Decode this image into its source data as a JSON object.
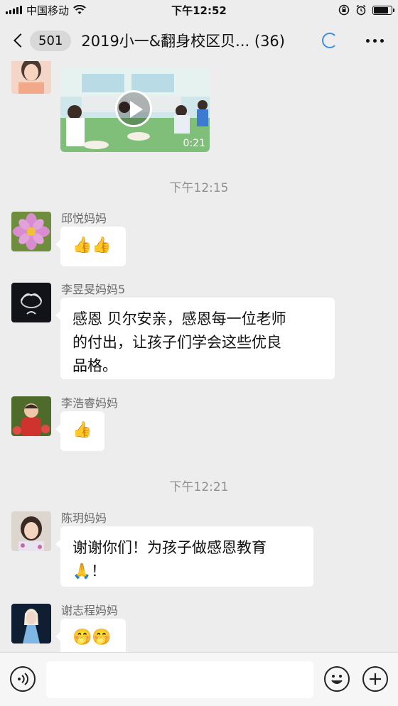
{
  "status_bar": {
    "carrier": "中国移动",
    "time": "下午12:52",
    "battery_level": 0.85
  },
  "nav": {
    "unread_count": "501",
    "title": "2019小一&翻身校区贝... (36)"
  },
  "video": {
    "duration": "0:21"
  },
  "messages": [
    {
      "kind": "divider",
      "text": "下午12:15"
    },
    {
      "kind": "message",
      "sender": "邱悦妈妈",
      "text": "👍👍"
    },
    {
      "kind": "message",
      "sender": "李昱旻妈妈5",
      "line1": "感恩 贝尔安亲，感恩每一位老师",
      "line2": "的付出，让孩子们学会这些优良",
      "line3": "品格。"
    },
    {
      "kind": "message",
      "sender": "李浩睿妈妈",
      "text": "👍"
    },
    {
      "kind": "divider",
      "text": "下午12:21"
    },
    {
      "kind": "message",
      "sender": "陈玥妈妈",
      "line1": "谢谢你们！为孩子做感恩教育",
      "line2": "🙏！"
    },
    {
      "kind": "message",
      "sender": "谢志程妈妈",
      "text": "🤭🤭"
    }
  ],
  "icons": {
    "back": "chevron-left-icon",
    "loading": "loading-spinner-icon",
    "more": "more-dots-icon",
    "voice": "voice-icon",
    "emoji": "emoji-icon",
    "plus": "plus-icon",
    "wifi": "wifi-icon",
    "alarm": "alarm-icon",
    "lock": "orientation-lock-icon",
    "battery": "battery-icon",
    "play": "play-icon"
  },
  "colors": {
    "chat_background": "#ededed",
    "bubble": "#ffffff",
    "accent_loading": "#3a8fe0"
  }
}
